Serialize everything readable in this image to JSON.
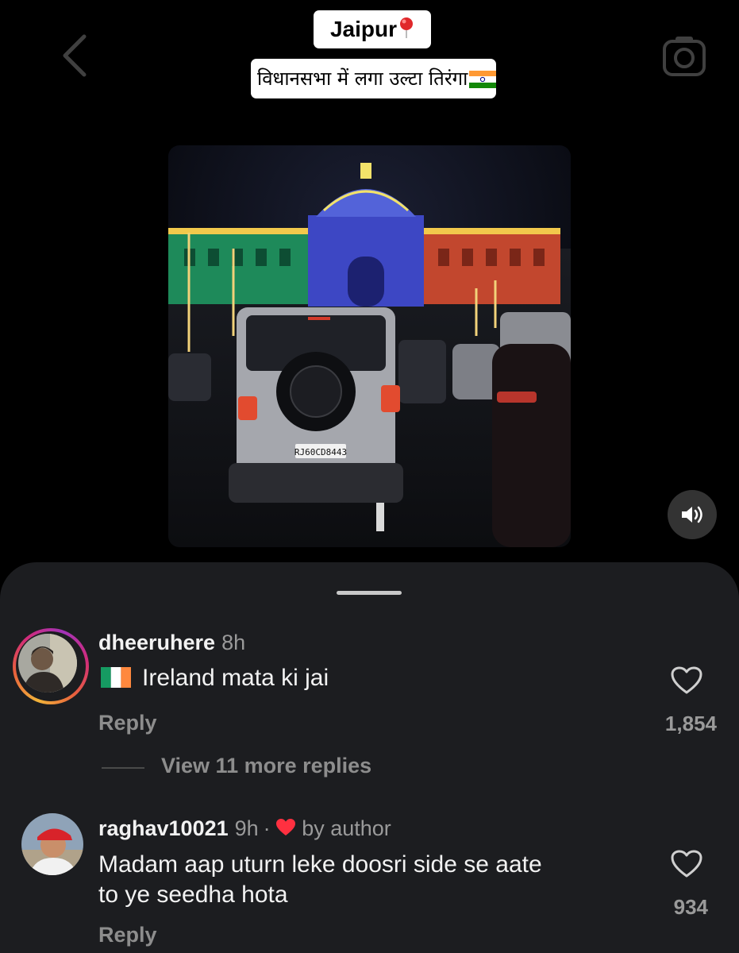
{
  "story": {
    "location_tag": "Jaipur",
    "caption": "विधानसभा में लगा उल्टा तिरंगा",
    "vehicle_plate": "RJ60CD8443"
  },
  "icons": {
    "back": "chevron-left-icon",
    "camera": "camera-icon",
    "sound": "speaker-icon",
    "pin": "location-pin-icon",
    "like": "heart-outline-icon"
  },
  "comments": [
    {
      "username": "dheeruhere",
      "time": "8h",
      "text": "Ireland mata ki jai",
      "reply_label": "Reply",
      "likes": "1,854",
      "view_replies": "View 11 more replies"
    },
    {
      "username": "raghav10021",
      "time": "9h",
      "badge": "by author",
      "text_line1": "Madam aap uturn leke doosri side se aate",
      "text_line2": "to ye seedha hota",
      "reply_label": "Reply",
      "likes": "934"
    }
  ],
  "colors": {
    "sheet_bg": "#1c1d20",
    "muted_text": "#9a9a9a",
    "author_heart": "#ff3040",
    "pin_red": "#e0282b"
  }
}
